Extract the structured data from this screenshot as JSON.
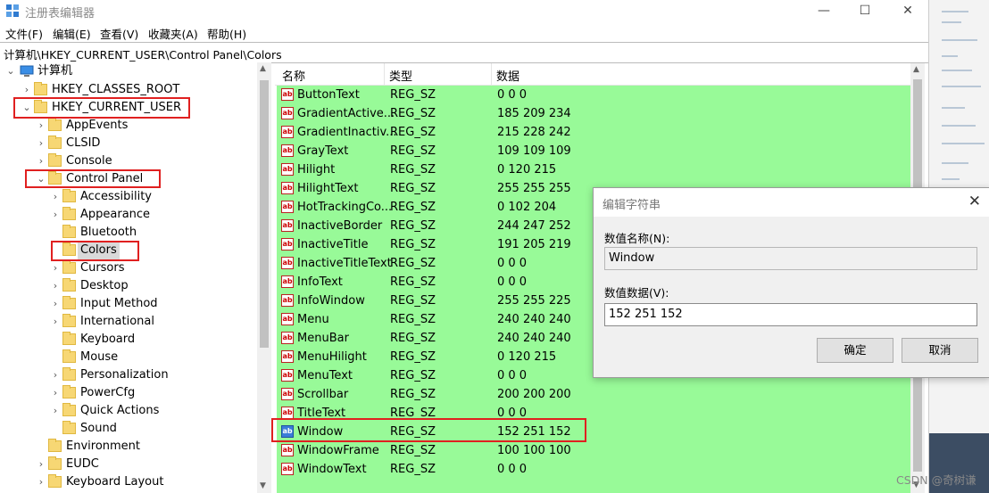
{
  "window": {
    "title": "注册表编辑器",
    "min_glyph": "—",
    "max_glyph": "☐",
    "close_glyph": "✕"
  },
  "menu": [
    "文件(F)",
    "编辑(E)",
    "查看(V)",
    "收藏夹(A)",
    "帮助(H)"
  ],
  "address": "计算机\\HKEY_CURRENT_USER\\Control Panel\\Colors",
  "tree": {
    "root": "计算机",
    "items": [
      {
        "label": "HKEY_CLASSES_ROOT",
        "level": 1,
        "expander": "›"
      },
      {
        "label": "HKEY_CURRENT_USER",
        "level": 1,
        "expander": "⌄"
      },
      {
        "label": "AppEvents",
        "level": 2,
        "expander": "›"
      },
      {
        "label": "CLSID",
        "level": 2,
        "expander": "›"
      },
      {
        "label": "Console",
        "level": 2,
        "expander": "›"
      },
      {
        "label": "Control Panel",
        "level": 2,
        "expander": "⌄"
      },
      {
        "label": "Accessibility",
        "level": 3,
        "expander": "›"
      },
      {
        "label": "Appearance",
        "level": 3,
        "expander": "›"
      },
      {
        "label": "Bluetooth",
        "level": 3,
        "expander": ""
      },
      {
        "label": "Colors",
        "level": 3,
        "expander": ""
      },
      {
        "label": "Cursors",
        "level": 3,
        "expander": "›"
      },
      {
        "label": "Desktop",
        "level": 3,
        "expander": "›"
      },
      {
        "label": "Input Method",
        "level": 3,
        "expander": "›"
      },
      {
        "label": "International",
        "level": 3,
        "expander": "›"
      },
      {
        "label": "Keyboard",
        "level": 3,
        "expander": ""
      },
      {
        "label": "Mouse",
        "level": 3,
        "expander": ""
      },
      {
        "label": "Personalization",
        "level": 3,
        "expander": "›"
      },
      {
        "label": "PowerCfg",
        "level": 3,
        "expander": "›"
      },
      {
        "label": "Quick Actions",
        "level": 3,
        "expander": "›"
      },
      {
        "label": "Sound",
        "level": 3,
        "expander": ""
      },
      {
        "label": "Environment",
        "level": 2,
        "expander": ""
      },
      {
        "label": "EUDC",
        "level": 2,
        "expander": "›"
      },
      {
        "label": "Keyboard Layout",
        "level": 2,
        "expander": "›"
      }
    ]
  },
  "list": {
    "columns": {
      "name": "名称",
      "type": "类型",
      "data": "数据"
    },
    "rows": [
      {
        "name": "ButtonText",
        "type": "REG_SZ",
        "data": "0 0 0"
      },
      {
        "name": "GradientActive...",
        "type": "REG_SZ",
        "data": "185 209 234"
      },
      {
        "name": "GradientInactiv...",
        "type": "REG_SZ",
        "data": "215 228 242"
      },
      {
        "name": "GrayText",
        "type": "REG_SZ",
        "data": "109 109 109"
      },
      {
        "name": "Hilight",
        "type": "REG_SZ",
        "data": "0 120 215"
      },
      {
        "name": "HilightText",
        "type": "REG_SZ",
        "data": "255 255 255"
      },
      {
        "name": "HotTrackingCo...",
        "type": "REG_SZ",
        "data": "0 102 204"
      },
      {
        "name": "InactiveBorder",
        "type": "REG_SZ",
        "data": "244 247 252"
      },
      {
        "name": "InactiveTitle",
        "type": "REG_SZ",
        "data": "191 205 219"
      },
      {
        "name": "InactiveTitleText",
        "type": "REG_SZ",
        "data": "0 0 0"
      },
      {
        "name": "InfoText",
        "type": "REG_SZ",
        "data": "0 0 0"
      },
      {
        "name": "InfoWindow",
        "type": "REG_SZ",
        "data": "255 255 225"
      },
      {
        "name": "Menu",
        "type": "REG_SZ",
        "data": "240 240 240"
      },
      {
        "name": "MenuBar",
        "type": "REG_SZ",
        "data": "240 240 240"
      },
      {
        "name": "MenuHilight",
        "type": "REG_SZ",
        "data": "0 120 215"
      },
      {
        "name": "MenuText",
        "type": "REG_SZ",
        "data": "0 0 0"
      },
      {
        "name": "Scrollbar",
        "type": "REG_SZ",
        "data": "200 200 200"
      },
      {
        "name": "TitleText",
        "type": "REG_SZ",
        "data": "0 0 0"
      },
      {
        "name": "Window",
        "type": "REG_SZ",
        "data": "152 251 152"
      },
      {
        "name": "WindowFrame",
        "type": "REG_SZ",
        "data": "100 100 100"
      },
      {
        "name": "WindowText",
        "type": "REG_SZ",
        "data": "0 0 0"
      }
    ],
    "background_color": "#98fa98",
    "icon_text": "ab"
  },
  "dialog": {
    "title": "编辑字符串",
    "close_glyph": "✕",
    "name_label": "数值名称(N):",
    "name_value": "Window",
    "data_label": "数值数据(V):",
    "data_value": "152 251 152",
    "ok": "确定",
    "cancel": "取消"
  },
  "watermark": "CSDN @奇树谦"
}
